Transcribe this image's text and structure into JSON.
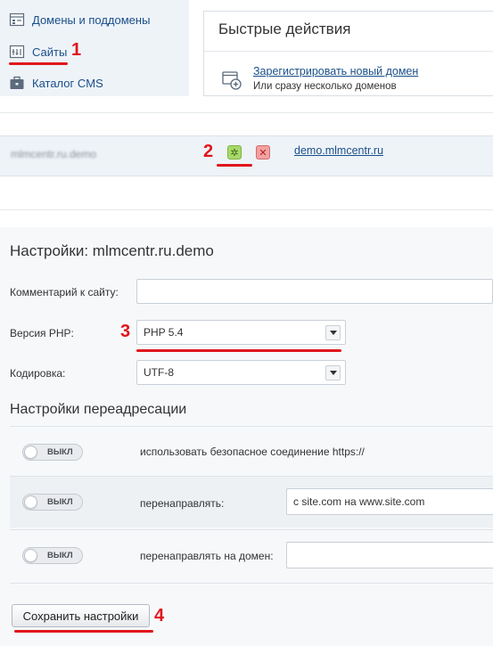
{
  "sidebar": {
    "items": [
      {
        "label": "Домены и поддомены",
        "icon": "domains-icon"
      },
      {
        "label": "Сайты",
        "icon": "sites-icon",
        "active": true
      },
      {
        "label": "Каталог CMS",
        "icon": "cms-catalog-icon"
      }
    ]
  },
  "quick_actions": {
    "title": "Быстрые действия",
    "register_link": "Зарегистрировать новый домен",
    "register_sub": "Или сразу несколько доменов"
  },
  "site_row": {
    "name": "mlmcentr.ru.demo",
    "domain_link": "demo.mlmcentr.ru"
  },
  "settings": {
    "title": "Настройки: mlmcentr.ru.demo",
    "comment_label": "Комментарий к сайту:",
    "comment_value": "",
    "php_label": "Версия PHP:",
    "php_value": "PHP 5.4",
    "encoding_label": "Кодировка:",
    "encoding_value": "UTF-8",
    "redirect_title": "Настройки переадресации",
    "redirects": [
      {
        "toggle": "ВЫКЛ",
        "label": "использовать безопасное соединение https://",
        "input": null
      },
      {
        "toggle": "ВЫКЛ",
        "label": "перенаправлять:",
        "input": "с site.com на www.site.com"
      },
      {
        "toggle": "ВЫКЛ",
        "label": "перенаправлять на домен:",
        "input": ""
      }
    ],
    "save_label": "Сохранить настройки"
  },
  "markers": [
    "1",
    "2",
    "3",
    "4"
  ],
  "colors": {
    "accent_red": "#e0161b",
    "link_blue": "#1a4f8a",
    "panel_bg": "#eef3f8"
  }
}
